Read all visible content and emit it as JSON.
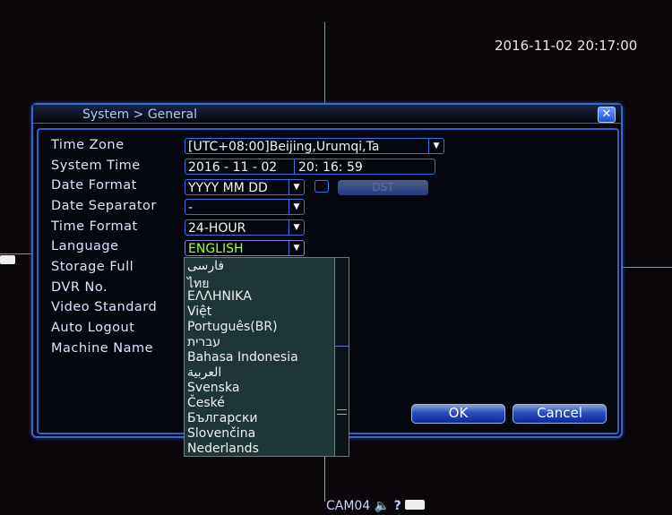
{
  "clock": "2016-11-02 20:17:00",
  "dialog": {
    "title": "System > General",
    "close_icon": "close-icon"
  },
  "rows": [
    {
      "label": "Time Zone",
      "value": "[UTC+08:00]Beijing,Urumqi,Ta"
    },
    {
      "label": "System Time",
      "date": "2016 - 11 - 02",
      "time": "20: 16: 59"
    },
    {
      "label": "Date Format",
      "value": "YYYY MM DD"
    },
    {
      "label": "Date Separator",
      "value": "-"
    },
    {
      "label": "Time Format",
      "value": "24-HOUR"
    },
    {
      "label": "Language",
      "value": "ENGLISH"
    },
    {
      "label": "Storage Full"
    },
    {
      "label": "DVR No."
    },
    {
      "label": "Video Standard"
    },
    {
      "label": "Auto Logout"
    },
    {
      "label": "Machine Name"
    }
  ],
  "dst_label": "DST",
  "language_options": [
    "فارسی",
    "ไทย",
    "ΕΛΛΗΝΙΚΑ",
    "Việt",
    "Português(BR)",
    "עברית",
    "Bahasa Indonesia",
    "العربية",
    "Svenska",
    "České",
    "Български",
    "Slovenčina",
    "Nederlands"
  ],
  "buttons": {
    "ok": "OK",
    "cancel": "Cancel"
  },
  "status": {
    "camera": "CAM04"
  },
  "colors": {
    "accent": "#3b6fe0",
    "language_value": "#9cff3a"
  }
}
